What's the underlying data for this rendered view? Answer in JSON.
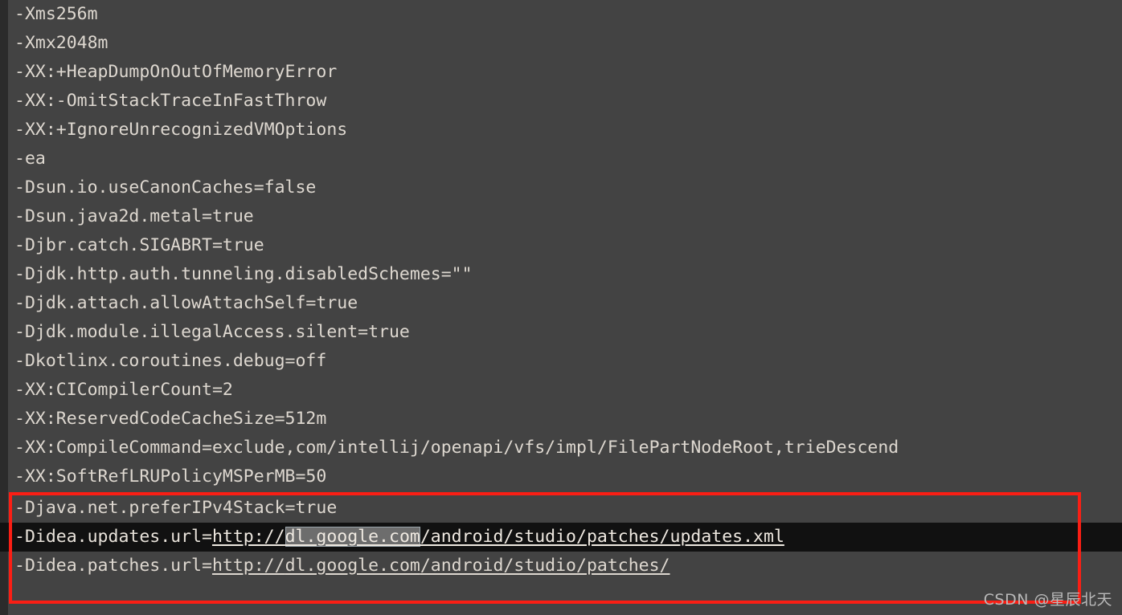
{
  "editor": {
    "background_color": "#434343",
    "text_color": "#ded8d0",
    "current_line_color": "#111111",
    "accent_color": "#fa1e14",
    "lines": [
      {
        "text": "-Xms256m"
      },
      {
        "text": "-Xmx2048m"
      },
      {
        "text": "-XX:+HeapDumpOnOutOfMemoryError"
      },
      {
        "text": "-XX:-OmitStackTraceInFastThrow"
      },
      {
        "text": "-XX:+IgnoreUnrecognizedVMOptions"
      },
      {
        "text": "-ea"
      },
      {
        "text": "-Dsun.io.useCanonCaches=false"
      },
      {
        "text": "-Dsun.java2d.metal=true"
      },
      {
        "text": "-Djbr.catch.SIGABRT=true"
      },
      {
        "text": "-Djdk.http.auth.tunneling.disabledSchemes=\"\""
      },
      {
        "text": "-Djdk.attach.allowAttachSelf=true"
      },
      {
        "text": "-Djdk.module.illegalAccess.silent=true"
      },
      {
        "text": "-Dkotlinx.coroutines.debug=off"
      },
      {
        "text": "-XX:CICompilerCount=2"
      },
      {
        "text": "-XX:ReservedCodeCacheSize=512m"
      },
      {
        "text": "-XX:CompileCommand=exclude,com/intellij/openapi/vfs/impl/FilePartNodeRoot,trieDescend"
      },
      {
        "text": "-XX:SoftRefLRUPolicyMSPerMB=50"
      },
      {
        "text": "-Djava.net.preferIPv4Stack=true"
      }
    ],
    "updates_line": {
      "prefix": "-Didea.updates.url=",
      "url_scheme": "http://",
      "url_host": "dl.google.com",
      "url_path": "/android/studio/patches/updates.xml"
    },
    "patches_line": {
      "prefix": "-Didea.patches.url=",
      "url_scheme": "http://",
      "url_host": "dl.google.com",
      "url_path": "/android/studio/patches/"
    }
  },
  "annotation": {
    "highlight_box_color": "#fa1e14"
  },
  "watermark": {
    "text": "CSDN @星辰北天"
  }
}
